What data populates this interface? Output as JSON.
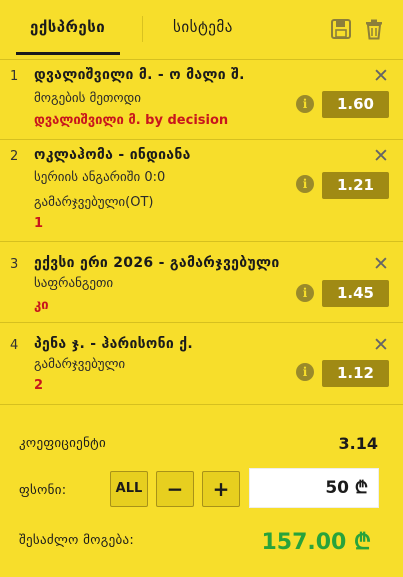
{
  "tabs": {
    "express": "ექსპრესი",
    "system": "სისტემა"
  },
  "icons": {
    "save": "save-icon",
    "trash": "trash-icon",
    "close": "close-icon",
    "info": "info-icon"
  },
  "bets": [
    {
      "index": "1",
      "title": "დვალიშვილი მ. - ო მალი შ.",
      "market": "მოგების მეთოდი",
      "extra": "",
      "pick": "დვალიშვილი მ. by decision",
      "odd": "1.60"
    },
    {
      "index": "2",
      "title": "ოკლაჰომა - ინდიანა",
      "market": "სერიის ანგარიში 0:0",
      "extra": "გამარჯვებული(OT)",
      "pick": "1",
      "odd": "1.21"
    },
    {
      "index": "3",
      "title": "ექვსი ერი 2026 - გამარჯვებული",
      "market": "საფრანგეთი",
      "extra": "",
      "pick": "კი",
      "odd": "1.45"
    },
    {
      "index": "4",
      "title": "პენა ჯ. - ჰარისონი ქ.",
      "market": "გამარჯვებული",
      "extra": "",
      "pick": "2",
      "odd": "1.12"
    }
  ],
  "summary": {
    "odds_label": "კოეფიციენტი",
    "odds_value": "3.14",
    "stake_label": "ფსონი:",
    "all_label": "ALL",
    "minus_label": "−",
    "plus_label": "+",
    "stake_value": "50 ₾",
    "payout_label": "შესაძლო მოგება:",
    "payout_value": "157.00 ₾"
  },
  "colors": {
    "background": "#f7de2b",
    "odds_button": "#a08a14",
    "pick_red": "#c8161d",
    "payout_green": "#28a33b"
  }
}
